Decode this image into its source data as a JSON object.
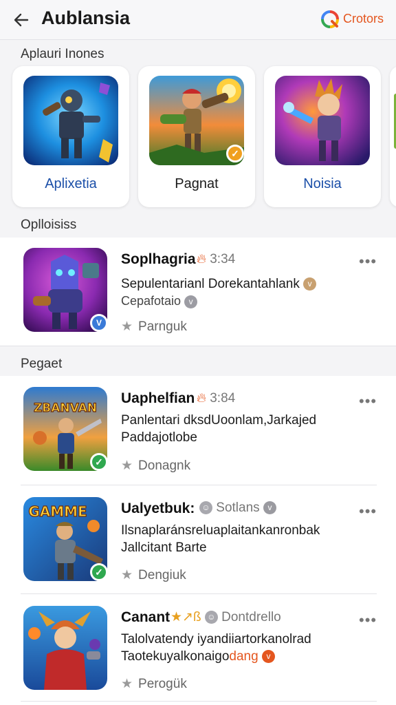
{
  "header": {
    "title": "Aublansia",
    "brand_label": "Crotors",
    "back_icon": "arrow-left-icon",
    "brand_icon": "colorful-q-logo-icon"
  },
  "featured": {
    "section_title": "Aplauri Inones",
    "cards": [
      {
        "name": "Aplixetia",
        "color": "#1b4fa8"
      },
      {
        "name": "Pagnat",
        "color": "#1b1b1b"
      },
      {
        "name": "Noisia",
        "color": "#1b4fa8"
      }
    ]
  },
  "section1": {
    "title": "Oplloisiss",
    "items": [
      {
        "name": "Soplhagria",
        "meta": "3:34",
        "desc": "Sepulentarianl Dorekantahlank",
        "sub": "Cepafotaio",
        "rating": "Parnguk"
      }
    ]
  },
  "section2": {
    "title": "Pegaet",
    "items": [
      {
        "name": "Uaphelfian",
        "meta": "3:84",
        "desc": "Panlentari dksdUoonlam,Jarkajed",
        "sub": "Paddajotlobe",
        "rating": "Donagnk",
        "art_text": "ZBANVAN"
      },
      {
        "name": "Ualyetbuk:",
        "meta": "Sotlans",
        "desc": "Ilsnaplaránsreluaplaitankanronbak",
        "sub": "Jallcitant Barte",
        "rating": "Dengiuk",
        "art_text": "GAMME"
      },
      {
        "name": "Canant",
        "meta_accent": "★↗ß",
        "meta": "Dontdrello",
        "desc": "Talolvatendy iyandiiartorkanolrad",
        "sub": "Taotekuyalkonaigo",
        "sub_accent": "dang",
        "rating": "Perogük"
      }
    ]
  },
  "colors": {
    "accent_orange": "#e4561f",
    "check_green": "#2fa84f",
    "card_name_blue": "#1b4fa8"
  }
}
